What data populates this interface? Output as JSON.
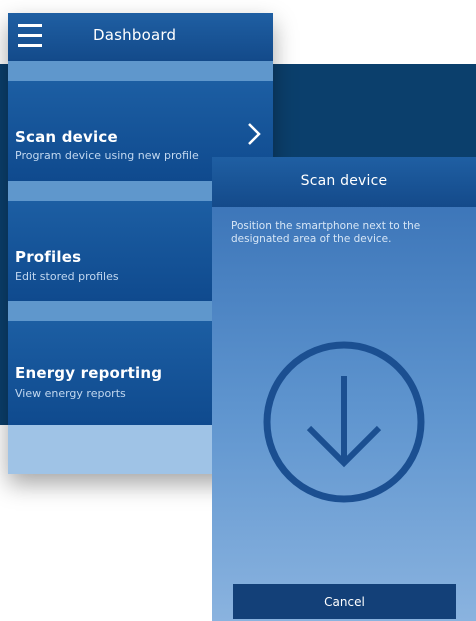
{
  "dashboard": {
    "title": "Dashboard",
    "items": [
      {
        "title": "Scan device",
        "subtitle": "Program device using new profile"
      },
      {
        "title": "Profiles",
        "subtitle": "Edit stored profiles"
      },
      {
        "title": "Energy reporting",
        "subtitle": "View energy reports"
      }
    ]
  },
  "scan": {
    "title": "Scan device",
    "instruction": "Position the smartphone next to the designated area of the device.",
    "cancel_label": "Cancel"
  },
  "icons": {
    "menu": "hamburger-menu-icon",
    "chevron": "chevron-right-icon",
    "download": "arrow-down-circle-icon"
  },
  "colors": {
    "header": "#1a57a0",
    "accent": "#134078",
    "backdrop": "#0b3f6c"
  }
}
